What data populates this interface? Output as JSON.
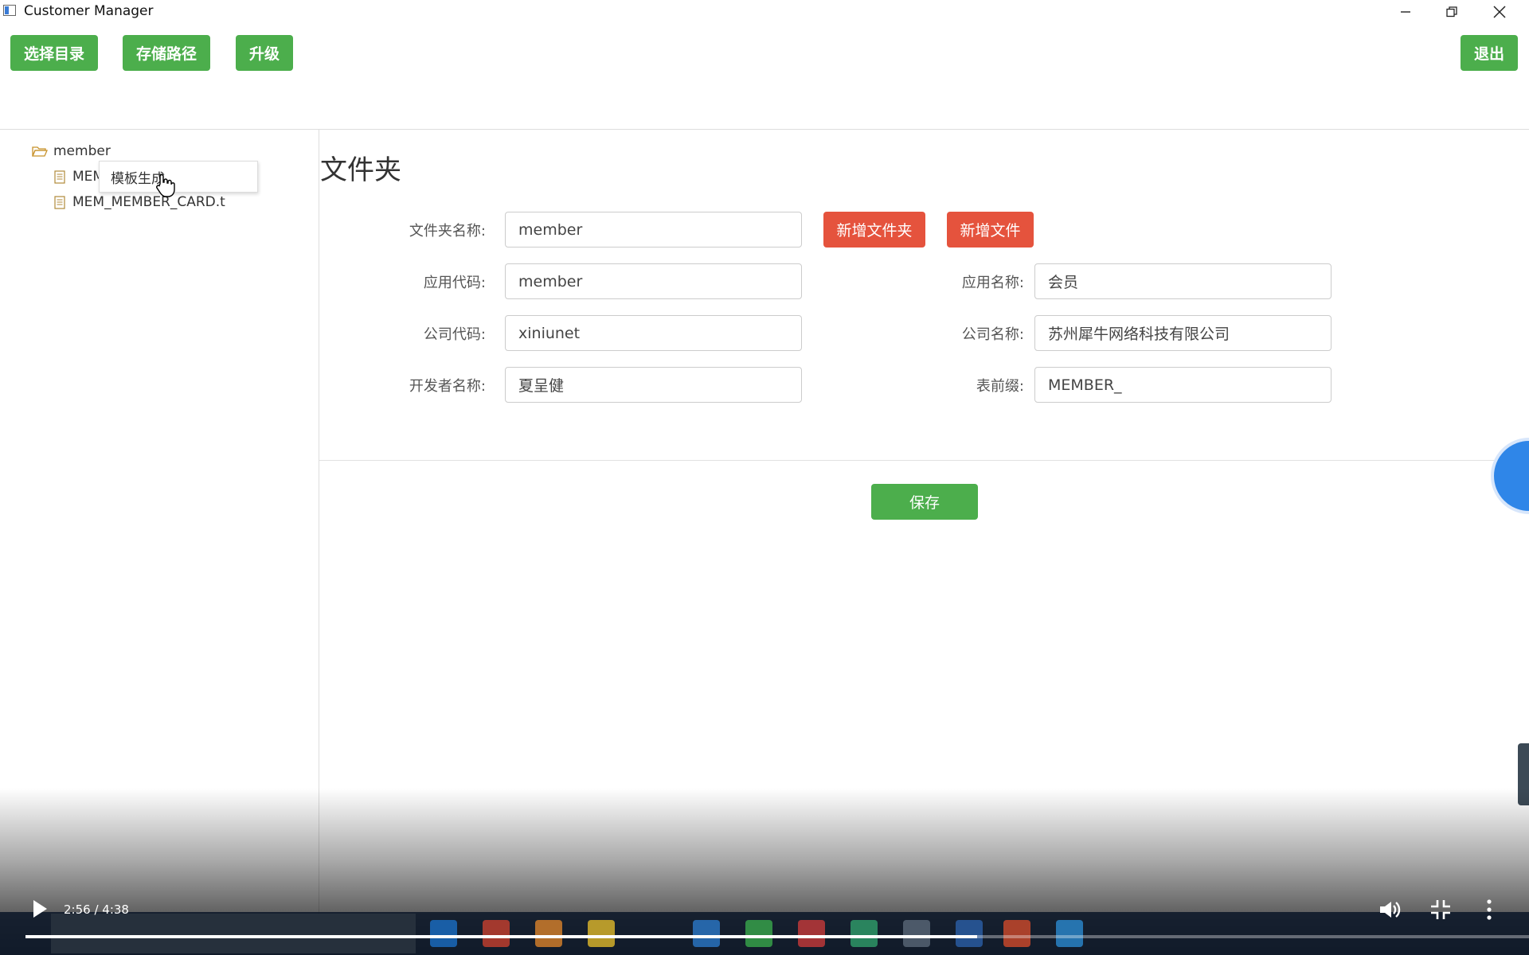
{
  "window": {
    "title": "Customer Manager"
  },
  "toolbar": {
    "select_dir": "选择目录",
    "storage_path": "存储路径",
    "upgrade": "升级",
    "exit": "退出"
  },
  "tree": {
    "root": "member",
    "files": [
      "MEM",
      "MEM_MEMBER_CARD.t"
    ],
    "context_menu": "模板生成"
  },
  "form": {
    "section_title": "文件夹",
    "folder_name_label": "文件夹名称:",
    "folder_name_value": "member",
    "add_folder_button": "新增文件夹",
    "add_file_button": "新增文件",
    "app_code_label": "应用代码:",
    "app_code_value": "member",
    "app_name_label": "应用名称:",
    "app_name_value": "会员",
    "company_code_label": "公司代码:",
    "company_code_value": "xiniunet",
    "company_name_label": "公司名称:",
    "company_name_value": "苏州犀牛网络科技有限公司",
    "developer_label": "开发者名称:",
    "developer_value": "夏呈健",
    "table_prefix_label": "表前缀:",
    "table_prefix_value": "MEMBER_",
    "save_button": "保存"
  },
  "player": {
    "time": "2:56 / 4:38",
    "progress_fraction": 0.633
  },
  "colors": {
    "green": "#4cae4c",
    "red": "#e5533d",
    "border": "#cccccc"
  }
}
